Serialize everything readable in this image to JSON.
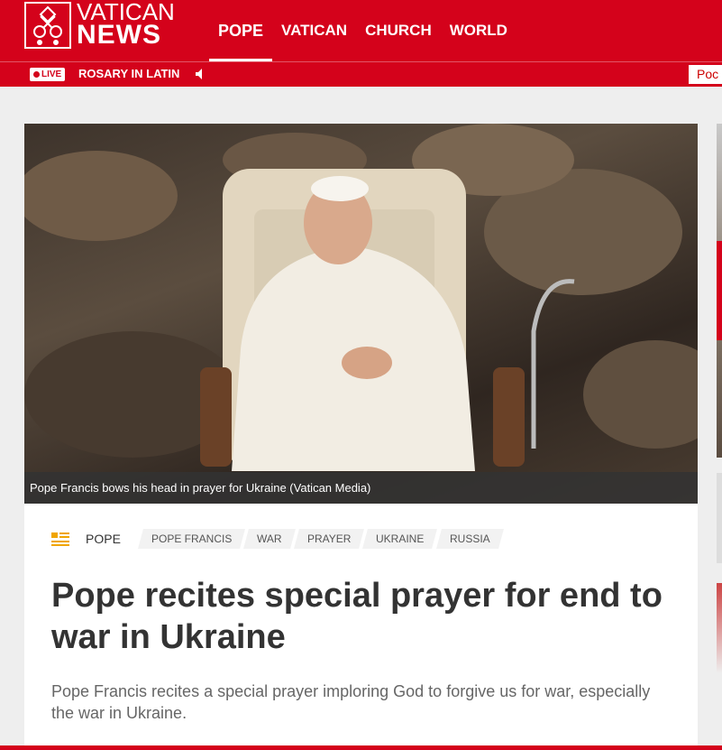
{
  "brand": {
    "line1": "VATICAN",
    "line2": "NEWS"
  },
  "nav": [
    {
      "label": "POPE",
      "active": true
    },
    {
      "label": "VATICAN",
      "active": false
    },
    {
      "label": "CHURCH",
      "active": false
    },
    {
      "label": "WORLD",
      "active": false
    }
  ],
  "live": {
    "badge": "LIVE",
    "title": "ROSARY IN LATIN",
    "podcast_tab": "Poc"
  },
  "article": {
    "caption": "Pope Francis bows his head in prayer for Ukraine  (Vatican Media)",
    "primary_tag": "POPE",
    "tags": [
      "POPE FRANCIS",
      "WAR",
      "PRAYER",
      "UKRAINE",
      "RUSSIA"
    ],
    "headline": "Pope recites special prayer for end to war in Ukraine",
    "subtitle": "Pope Francis recites a special prayer imploring God to forgive us for war, especially the war in Ukraine."
  },
  "colors": {
    "brand_red": "#d4021b",
    "tag_icon": "#f0a500"
  },
  "icons": [
    "vatican-keys-logo-icon",
    "speaker-icon",
    "article-list-icon"
  ]
}
